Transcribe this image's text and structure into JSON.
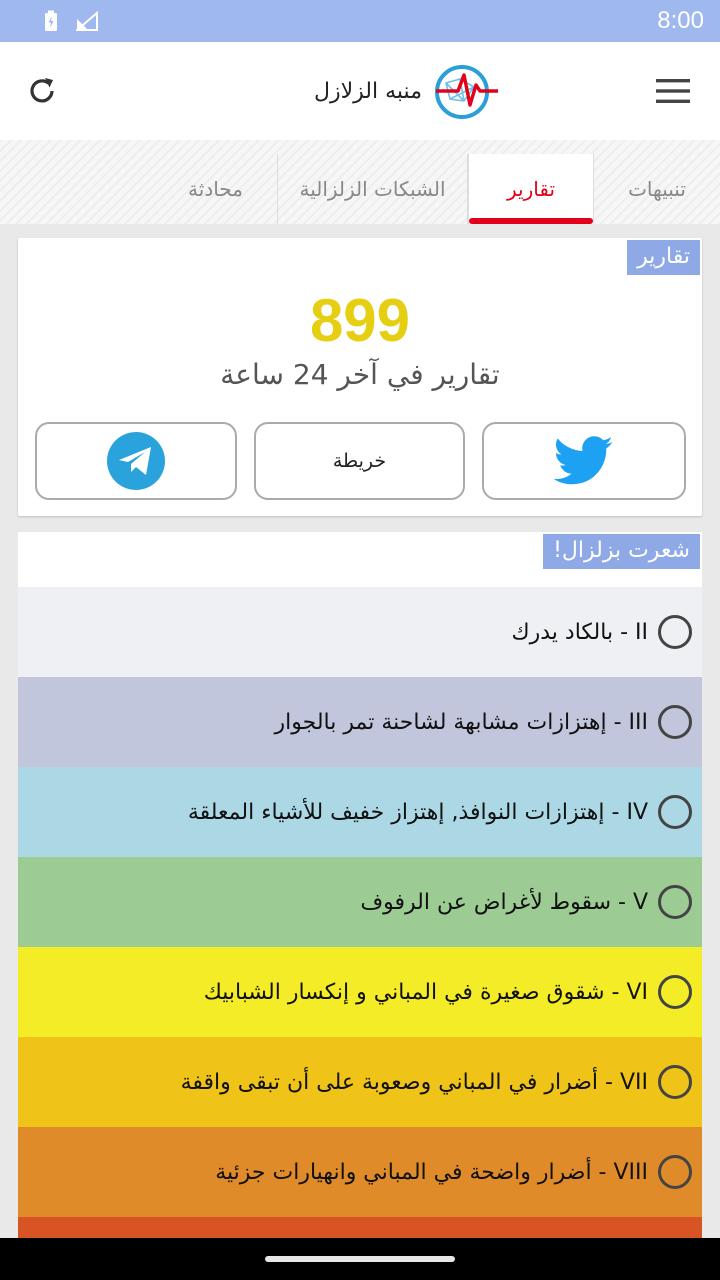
{
  "status_bar": {
    "time": "8:00",
    "icons": [
      "battery-icon",
      "signal-icon"
    ]
  },
  "app_bar": {
    "title": "منبه الزلازل",
    "logo_icon": "earthquake-logo-icon",
    "refresh_icon": "refresh-icon",
    "menu_icon": "hamburger-menu-icon"
  },
  "tabs": [
    {
      "label": "تنبيهات",
      "active": false
    },
    {
      "label": "تقارير",
      "active": true
    },
    {
      "label": "الشبكات الزلزالية",
      "active": false
    },
    {
      "label": "محادثة",
      "active": false
    }
  ],
  "reports": {
    "section_label": "تقارير",
    "count": "899",
    "caption": "تقارير في آخر 24 ساعة",
    "buttons": {
      "map_label": "خريطة",
      "twitter_icon": "twitter-icon",
      "telegram_icon": "telegram-icon"
    }
  },
  "felt": {
    "section_label": "شعرت بزلزال!",
    "levels": [
      {
        "text": "II - بالكاد يدرك",
        "color": "#eef0f4"
      },
      {
        "text": "III - إهتزازات مشابهة لشاحنة تمر بالجوار",
        "color": "#c2c6dc"
      },
      {
        "text": "IV - إهتزازات النوافذ, إهتزاز خفيف للأشياء المعلقة",
        "color": "#acd7e4"
      },
      {
        "text": "V - سقوط لأغراض عن الرفوف",
        "color": "#9ccb94"
      },
      {
        "text": "VI - شقوق صغيرة في المباني و إنكسار الشبابيك",
        "color": "#f4ec27"
      },
      {
        "text": "VII - أضرار في المباني وصعوبة على أن تبقى واقفة",
        "color": "#f0c318"
      },
      {
        "text": "VIII - أضرار واضحة في المباني وانهيارات جزئية",
        "color": "#e08b2a"
      },
      {
        "text": "",
        "color": "#d85424"
      }
    ]
  },
  "colors": {
    "accent_red": "#e3001b",
    "count_yellow": "#e6cf13",
    "label_blue": "#8fa8e6",
    "status_bar": "#9fb8ee"
  }
}
